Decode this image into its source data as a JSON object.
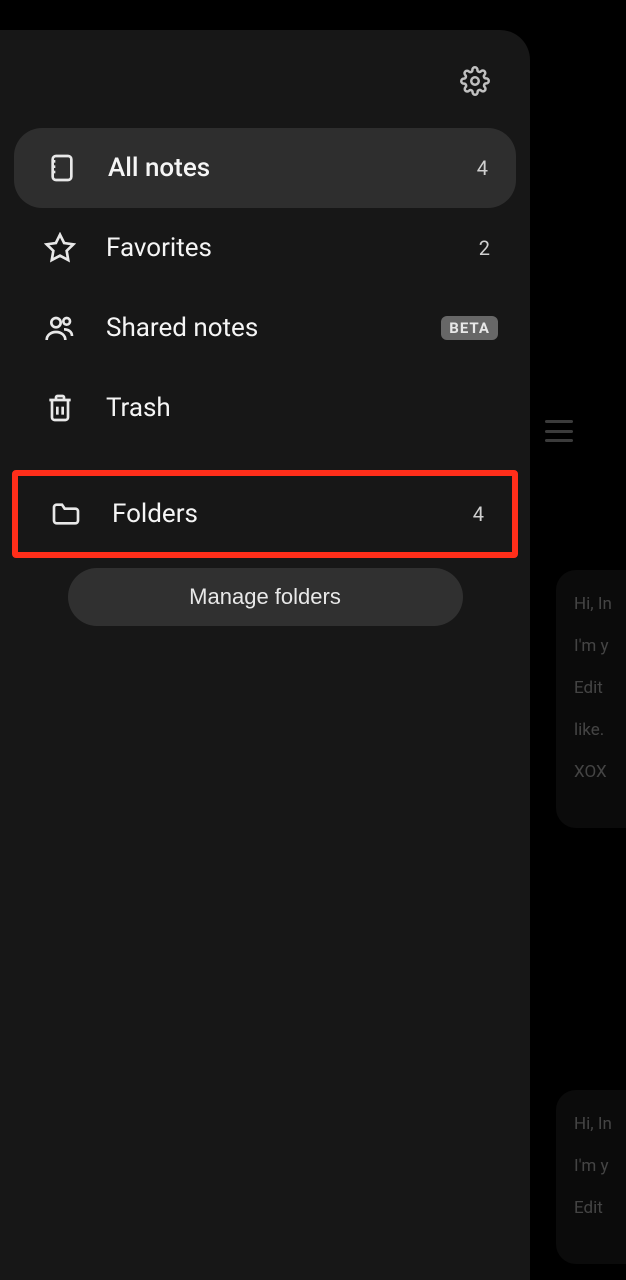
{
  "menu": {
    "all_notes": {
      "label": "All notes",
      "count": "4"
    },
    "favorites": {
      "label": "Favorites",
      "count": "2"
    },
    "shared_notes": {
      "label": "Shared notes",
      "badge": "BETA"
    },
    "trash": {
      "label": "Trash"
    },
    "folders": {
      "label": "Folders",
      "count": "4"
    }
  },
  "manage_folders_label": "Manage folders",
  "background": {
    "lines": [
      "Hi, In",
      "I'm y",
      "Edit",
      "like.",
      "XOX"
    ],
    "lines2": [
      "Hi, In",
      "I'm y",
      "Edit"
    ]
  }
}
